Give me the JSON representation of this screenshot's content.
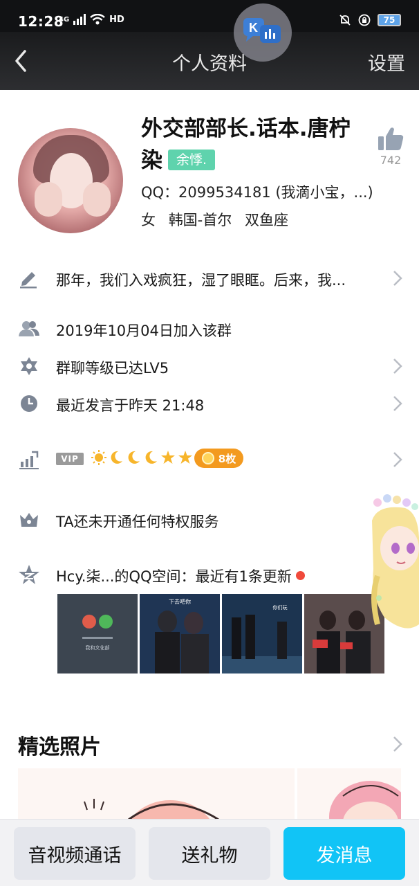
{
  "status_bar": {
    "time": "12:28",
    "network": "4G",
    "hd": "HD",
    "battery": "75"
  },
  "nav": {
    "title": "个人资料",
    "settings": "设置"
  },
  "profile": {
    "name": "外交部部长.话本.唐柠染",
    "level_tag": "余悸.",
    "likes": "742",
    "qq": "QQ：2099534181 (我滴小宝，...)",
    "gender": "女",
    "location": "韩国-首尔",
    "zodiac": "双鱼座"
  },
  "rows": {
    "signature": "那年，我们入戏疯狂，湿了眼眶。后来，我...",
    "joined": "2019年10月04日加入该群",
    "group_level": "群聊等级已达LV5",
    "last_speak": "最近发言于昨天 21:48",
    "vip_label": "VIP",
    "medal_count": "8枚",
    "privilege": "TA还未开通任何特权服务",
    "qzone": "Hcy.柒...的QQ空间：最近有1条更新"
  },
  "thumbs": [
    {
      "caption": "我和文化部"
    },
    {
      "caption": "下去吧你"
    },
    {
      "caption": "你们玩"
    },
    {
      "caption": ""
    }
  ],
  "featured": {
    "title": "精选照片"
  },
  "bottom": {
    "av_call": "音视频通话",
    "gift": "送礼物",
    "message": "发消息"
  },
  "colors": {
    "accent": "#11c4f6",
    "level_tag": "#5fd3ad",
    "medal": "#f39a1f",
    "red_dot": "#f04a3b"
  }
}
